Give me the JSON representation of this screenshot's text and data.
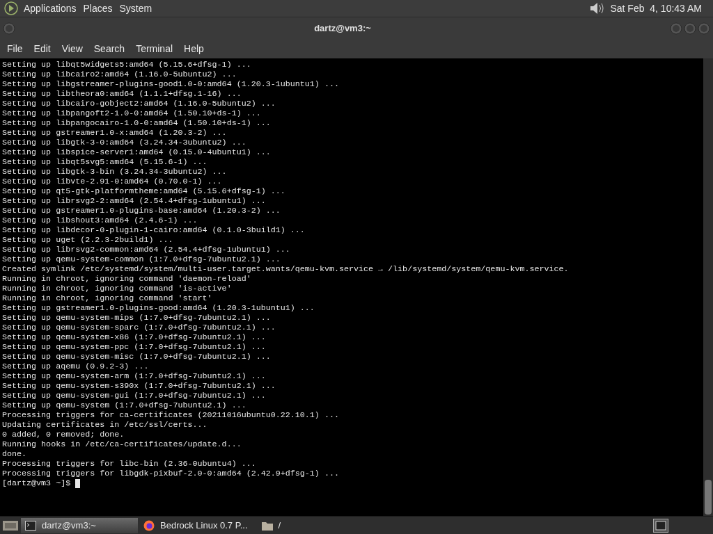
{
  "top_panel": {
    "menus": [
      "Applications",
      "Places",
      "System"
    ],
    "clock": "Sat Feb  4, 10:43 AM"
  },
  "window": {
    "title": "dartz@vm3:~"
  },
  "menu_bar": [
    "File",
    "Edit",
    "View",
    "Search",
    "Terminal",
    "Help"
  ],
  "terminal": {
    "lines": [
      "Setting up libqt5widgets5:amd64 (5.15.6+dfsg-1) ...",
      "Setting up libcairo2:amd64 (1.16.0-5ubuntu2) ...",
      "Setting up libgstreamer-plugins-good1.0-0:amd64 (1.20.3-1ubuntu1) ...",
      "Setting up libtheora0:amd64 (1.1.1+dfsg.1-16) ...",
      "Setting up libcairo-gobject2:amd64 (1.16.0-5ubuntu2) ...",
      "Setting up libpangoft2-1.0-0:amd64 (1.50.10+ds-1) ...",
      "Setting up libpangocairo-1.0-0:amd64 (1.50.10+ds-1) ...",
      "Setting up gstreamer1.0-x:amd64 (1.20.3-2) ...",
      "Setting up libgtk-3-0:amd64 (3.24.34-3ubuntu2) ...",
      "Setting up libspice-server1:amd64 (0.15.0-4ubuntu1) ...",
      "Setting up libqt5svg5:amd64 (5.15.6-1) ...",
      "Setting up libgtk-3-bin (3.24.34-3ubuntu2) ...",
      "Setting up libvte-2.91-0:amd64 (0.70.0-1) ...",
      "Setting up qt5-gtk-platformtheme:amd64 (5.15.6+dfsg-1) ...",
      "Setting up librsvg2-2:amd64 (2.54.4+dfsg-1ubuntu1) ...",
      "Setting up gstreamer1.0-plugins-base:amd64 (1.20.3-2) ...",
      "Setting up libshout3:amd64 (2.4.6-1) ...",
      "Setting up libdecor-0-plugin-1-cairo:amd64 (0.1.0-3build1) ...",
      "Setting up uget (2.2.3-2build1) ...",
      "Setting up librsvg2-common:amd64 (2.54.4+dfsg-1ubuntu1) ...",
      "Setting up qemu-system-common (1:7.0+dfsg-7ubuntu2.1) ...",
      "Created symlink /etc/systemd/system/multi-user.target.wants/qemu-kvm.service → /lib/systemd/system/qemu-kvm.service.",
      "Running in chroot, ignoring command 'daemon-reload'",
      "Running in chroot, ignoring command 'is-active'",
      "Running in chroot, ignoring command 'start'",
      "Setting up gstreamer1.0-plugins-good:amd64 (1.20.3-1ubuntu1) ...",
      "Setting up qemu-system-mips (1:7.0+dfsg-7ubuntu2.1) ...",
      "Setting up qemu-system-sparc (1:7.0+dfsg-7ubuntu2.1) ...",
      "Setting up qemu-system-x86 (1:7.0+dfsg-7ubuntu2.1) ...",
      "Setting up qemu-system-ppc (1:7.0+dfsg-7ubuntu2.1) ...",
      "Setting up qemu-system-misc (1:7.0+dfsg-7ubuntu2.1) ...",
      "Setting up aqemu (0.9.2-3) ...",
      "Setting up qemu-system-arm (1:7.0+dfsg-7ubuntu2.1) ...",
      "Setting up qemu-system-s390x (1:7.0+dfsg-7ubuntu2.1) ...",
      "Setting up qemu-system-gui (1:7.0+dfsg-7ubuntu2.1) ...",
      "Setting up qemu-system (1:7.0+dfsg-7ubuntu2.1) ...",
      "Processing triggers for ca-certificates (20211016ubuntu0.22.10.1) ...",
      "Updating certificates in /etc/ssl/certs...",
      "0 added, 0 removed; done.",
      "Running hooks in /etc/ca-certificates/update.d...",
      "done.",
      "Processing triggers for libc-bin (2.36-0ubuntu4) ...",
      "Processing triggers for libgdk-pixbuf-2.0-0:amd64 (2.42.9+dfsg-1) ..."
    ],
    "prompt": "[dartz@vm3 ~]$"
  },
  "taskbar": {
    "items": [
      {
        "kind": "terminal",
        "label": "dartz@vm3:~",
        "selected": true
      },
      {
        "kind": "browser",
        "label": "Bedrock Linux 0.7 P...",
        "selected": false
      },
      {
        "kind": "folder",
        "label": "/",
        "selected": false
      }
    ]
  }
}
